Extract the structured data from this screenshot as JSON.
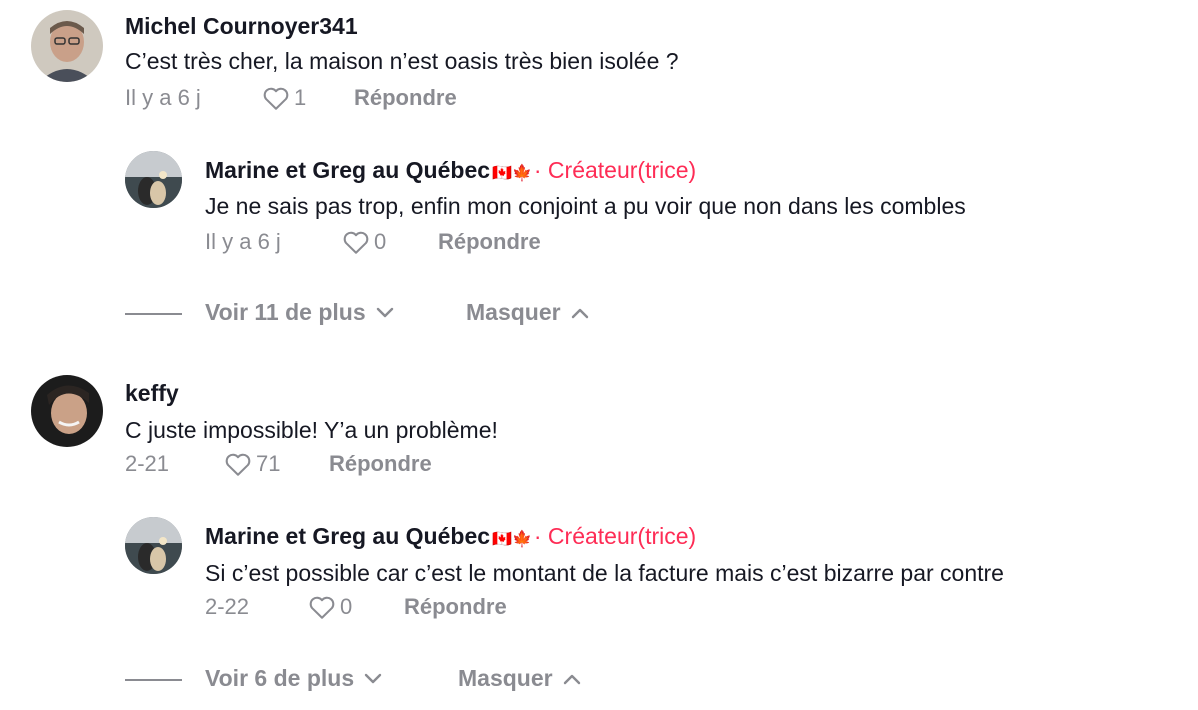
{
  "comments": [
    {
      "username": "Michel Cournoyer341",
      "text": "C’est très cher, la maison n’est oasis très bien isolée ?",
      "time": "Il y a 6 j",
      "likes": "1",
      "reply_label": "Répondre",
      "reply": {
        "username": "Marine et Greg au Québec",
        "flags": "🇨🇦🍁",
        "creator_label": "· Créateur(trice)",
        "text": "Je ne sais pas trop, enfin mon conjoint a pu voir que non dans les combles",
        "time": "Il y a 6 j",
        "likes": "0",
        "reply_label": "Répondre"
      },
      "view_more": "Voir 11 de plus",
      "hide": "Masquer"
    },
    {
      "username": "keffy",
      "text": "C juste impossible! Y’a un problème!",
      "time": "2-21",
      "likes": "71",
      "reply_label": "Répondre",
      "reply": {
        "username": "Marine et Greg au Québec",
        "flags": "🇨🇦🍁",
        "creator_label": "· Créateur(trice)",
        "text": "Si c’est possible car c’est le montant de la facture mais c’est bizarre par contre",
        "time": "2-22",
        "likes": "0",
        "reply_label": "Répondre"
      },
      "view_more": "Voir 6 de plus",
      "hide": "Masquer"
    }
  ],
  "colors": {
    "text": "#161823",
    "muted": "#8a8b91",
    "creator": "#fe2c55"
  },
  "icons": {
    "like": "heart-outline-icon",
    "expand": "chevron-down-icon",
    "collapse": "chevron-up-icon"
  }
}
